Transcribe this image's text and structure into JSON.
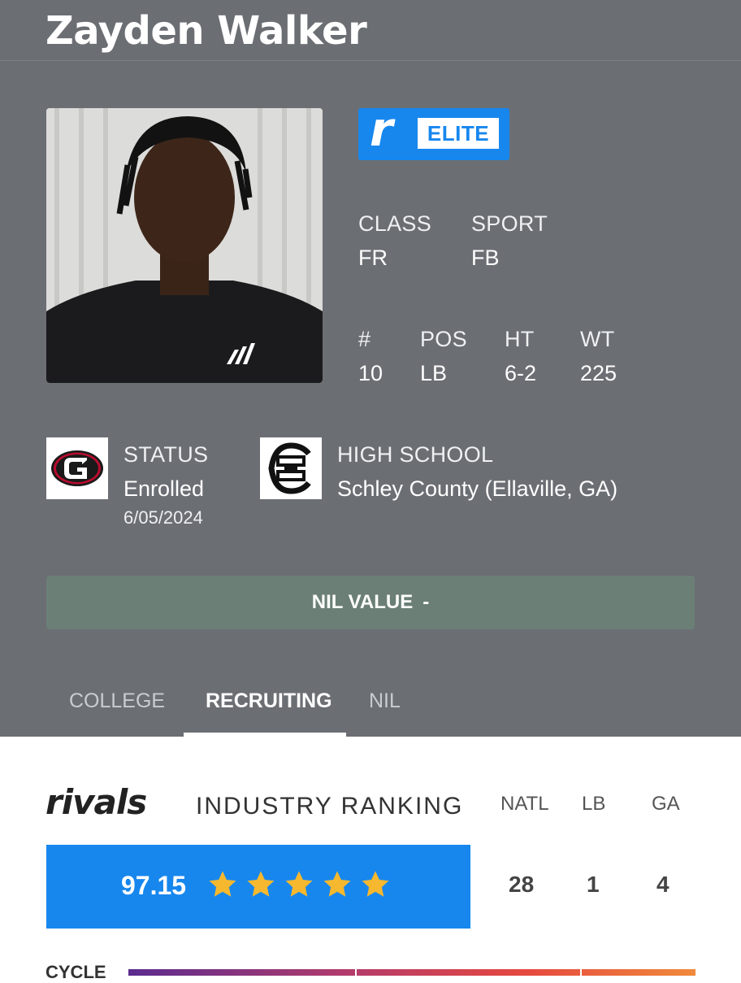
{
  "player": {
    "name": "Zayden Walker"
  },
  "badge": {
    "label": "ELITE"
  },
  "info": {
    "class_label": "CLASS",
    "class_value": "FR",
    "sport_label": "SPORT",
    "sport_value": "FB",
    "number_label": "#",
    "number_value": "10",
    "pos_label": "POS",
    "pos_value": "LB",
    "ht_label": "HT",
    "ht_value": "6-2",
    "wt_label": "WT",
    "wt_value": "225"
  },
  "status": {
    "label": "STATUS",
    "value": "Enrolled",
    "date": "6/05/2024"
  },
  "high_school": {
    "label": "HIGH SCHOOL",
    "value": "Schley County (Ellaville, GA)"
  },
  "nil": {
    "label": "NIL VALUE",
    "value": "-"
  },
  "tabs": [
    {
      "label": "COLLEGE",
      "active": false
    },
    {
      "label": "RECRUITING",
      "active": true
    },
    {
      "label": "NIL",
      "active": false
    }
  ],
  "ranking": {
    "brand": "rivals",
    "title": "INDUSTRY RANKING",
    "score": "97.15",
    "stars": 5,
    "columns": [
      "NATL",
      "LB",
      "GA"
    ],
    "values": [
      "28",
      "1",
      "4"
    ]
  },
  "cycle": {
    "label": "CYCLE"
  },
  "colors": {
    "header_bg": "#6b6e73",
    "accent_blue": "#1787ee",
    "nil_bar": "#6b7f76",
    "star_gold": "#f5b82e"
  }
}
